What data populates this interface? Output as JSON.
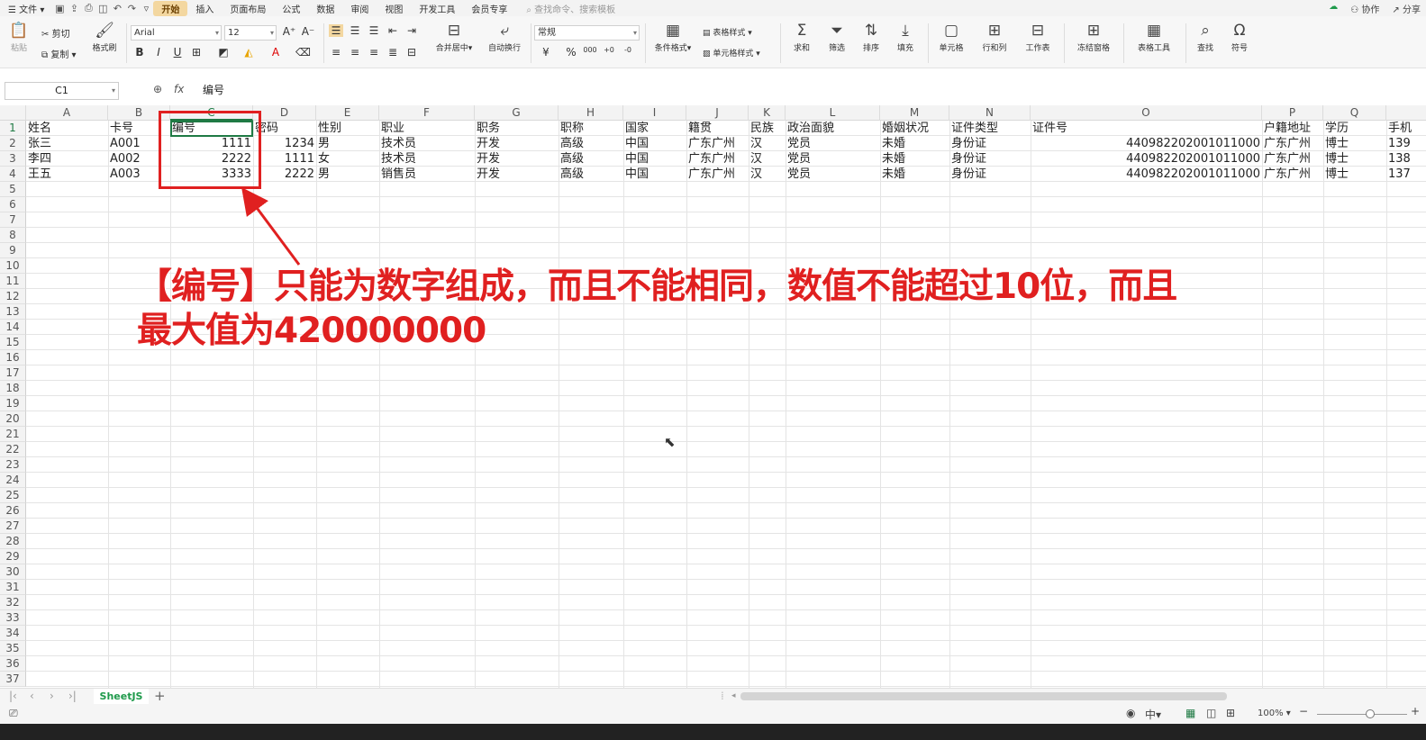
{
  "menubar": {
    "file": "文件",
    "tabs": [
      "开始",
      "插入",
      "页面布局",
      "公式",
      "数据",
      "审阅",
      "视图",
      "开发工具",
      "会员专享"
    ],
    "active_tab": "开始",
    "search_placeholder": "查找命令、搜索模板",
    "collab": "协作",
    "share": "分享"
  },
  "ribbon": {
    "paste": "粘贴",
    "cut": "剪切",
    "copy": "复制",
    "format_painter": "格式刷",
    "font_name": "Arial",
    "font_size": "12",
    "merge_center": "合并居中",
    "wrap_text": "自动换行",
    "number_format": "常规",
    "conditional_format": "条件格式",
    "table_style": "表格样式",
    "cell_style": "单元格样式",
    "sum": "求和",
    "filter": "筛选",
    "sort": "排序",
    "fill": "填充",
    "cell": "单元格",
    "row_col": "行和列",
    "worksheet": "工作表",
    "freeze": "冻结窗格",
    "table_tools": "表格工具",
    "find": "查找",
    "symbol": "符号"
  },
  "formula_bar": {
    "cell_ref": "C1",
    "fx": "fx",
    "content": "编号"
  },
  "columns": [
    "A",
    "B",
    "C",
    "D",
    "E",
    "F",
    "G",
    "H",
    "I",
    "J",
    "K",
    "L",
    "M",
    "N",
    "O",
    "P",
    "Q"
  ],
  "column_extra_partial": "手机",
  "selected_column": "C",
  "rows": {
    "count": 37,
    "selected_row": 1
  },
  "table": {
    "headers": [
      "姓名",
      "卡号",
      "编号",
      "密码",
      "性别",
      "职业",
      "职务",
      "职称",
      "国家",
      "籍贯",
      "民族",
      "政治面貌",
      "婚姻状况",
      "证件类型",
      "证件号",
      "户籍地址",
      "学历",
      "手机"
    ],
    "data": [
      [
        "张三",
        "A001",
        "1111",
        "1234",
        "男",
        "技术员",
        "开发",
        "高级",
        "中国",
        "广东广州",
        "汉",
        "党员",
        "未婚",
        "身份证",
        "440982202001011000",
        "广东广州",
        "博士",
        "139"
      ],
      [
        "李四",
        "A002",
        "2222",
        "1111",
        "女",
        "技术员",
        "开发",
        "高级",
        "中国",
        "广东广州",
        "汉",
        "党员",
        "未婚",
        "身份证",
        "440982202001011000",
        "广东广州",
        "博士",
        "138"
      ],
      [
        "王五",
        "A003",
        "3333",
        "2222",
        "男",
        "销售员",
        "开发",
        "高级",
        "中国",
        "广东广州",
        "汉",
        "党员",
        "未婚",
        "身份证",
        "440982202001011000",
        "广东广州",
        "博士",
        "137"
      ]
    ]
  },
  "annotation": {
    "line1": "【编号】只能为数字组成，而且不能相同，数值不能超过10位，而且",
    "line2": "最大值为420000000"
  },
  "sheet_tabs": [
    "SheetJS"
  ],
  "status": {
    "zoom": "100%"
  },
  "colors": {
    "accent_green": "#1f7a44",
    "annotation_red": "#e02020",
    "active_tab_bg": "#f3d7a0"
  }
}
